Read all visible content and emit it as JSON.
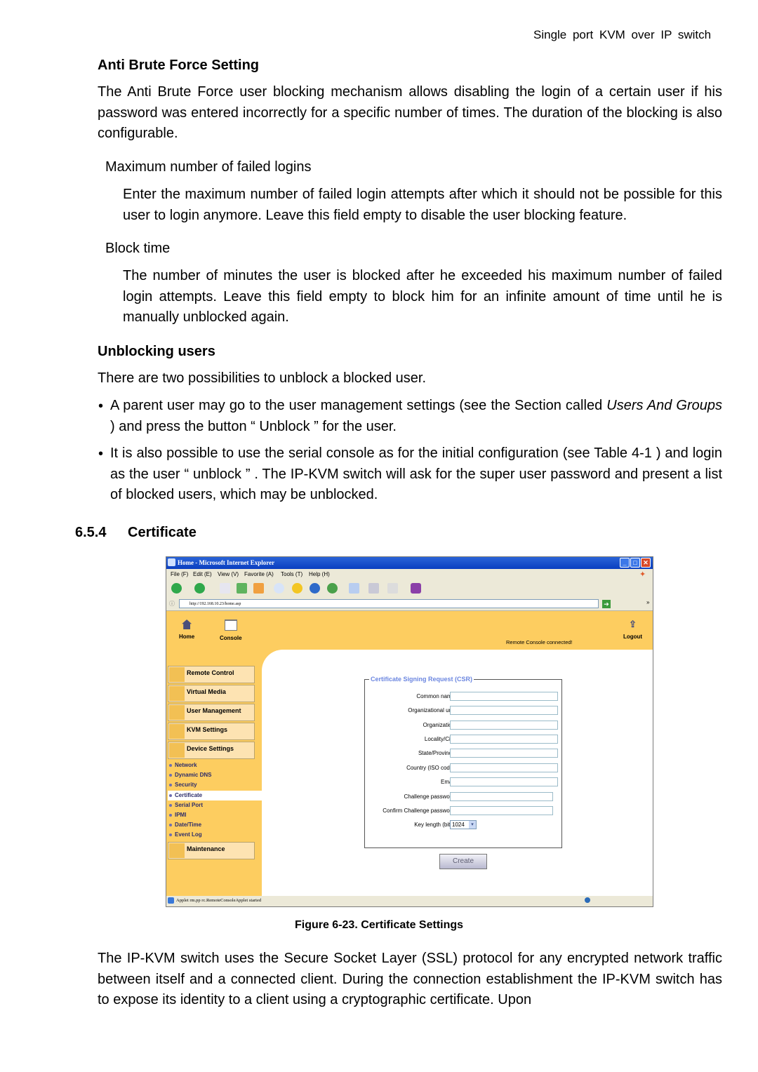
{
  "page_header": "Single port KVM over IP switch",
  "anti_brute_force": {
    "heading": "Anti Brute Force Setting",
    "intro": "The Anti Brute Force user blocking mechanism allows disabling the login of a certain user if his password was entered incorrectly for a specific number of times. The duration of the blocking is also configurable.",
    "max_failed_term": "Maximum number of failed logins",
    "max_failed_desc": "Enter the maximum number of failed login attempts after which it should not be possible for this user to login anymore. Leave this field empty to disable the user blocking feature.",
    "block_time_term": "Block time",
    "block_time_desc": "The number of minutes the user is blocked after he exceeded his maximum number of failed login attempts. Leave this field empty to block him for an infinite amount of time until he is manually unblocked again."
  },
  "unblocking": {
    "heading": "Unblocking users",
    "intro": "There are two possibilities to unblock a blocked user.",
    "bullet_1_pre": "A parent user may go to the user management settings (see the Section called ",
    "bullet_1_italic": "Users And Groups",
    "bullet_1_post": " ) and press the button “ Unblock ” for the user.",
    "bullet_2": "It is also possible to use the serial console as for the initial configuration (see Table 4-1 ) and login as the user “ unblock ” . The IP-KVM switch will ask for the super user password and present a list of blocked users, which may be unblocked."
  },
  "section": {
    "number": "6.5.4",
    "title": "Certificate"
  },
  "screenshot": {
    "window_title": "Home - Microsoft Internet Explorer",
    "menu": [
      "File (F)",
      "Edit (E)",
      "View (V)",
      "Favorite (A)",
      "Tools (T)",
      "Help (H)"
    ],
    "address": "http://192.168.10.23/home.asp",
    "nav": {
      "home": "Home",
      "console": "Console",
      "logout": "Logout",
      "status": "Remote Console connected!"
    },
    "sidebar_buttons": [
      "Remote Control",
      "Virtual Media",
      "User Management",
      "KVM Settings",
      "Device Settings"
    ],
    "sidebar_sub": [
      "Network",
      "Dynamic DNS",
      "Security",
      "Certificate",
      "Serial Port",
      "IPMI",
      "Date/Time",
      "Event Log"
    ],
    "sidebar_active": "Certificate",
    "maintenance": "Maintenance",
    "csr": {
      "legend": "Certificate Signing Request (CSR)",
      "fields": [
        "Common name",
        "Organizational unit",
        "Organization",
        "Locality/City",
        "State/Province",
        "Country (ISO code)",
        "Email",
        "Challenge password",
        "Confirm Challenge password"
      ],
      "key_length_label": "Key length (bits)",
      "key_length_value": "1024",
      "create_label": "Create"
    },
    "status_bar": "Applet rm.pp rc.RemoteConsoleApplet started"
  },
  "caption": "Figure 6-23. Certificate Settings",
  "closing_paragraph": "The IP-KVM switch uses the Secure Socket Layer (SSL) protocol for any encrypted network traffic between itself and a connected client. During the connection establishment the IP-KVM switch has to expose its identity to a client using a cryptographic certificate. Upon"
}
